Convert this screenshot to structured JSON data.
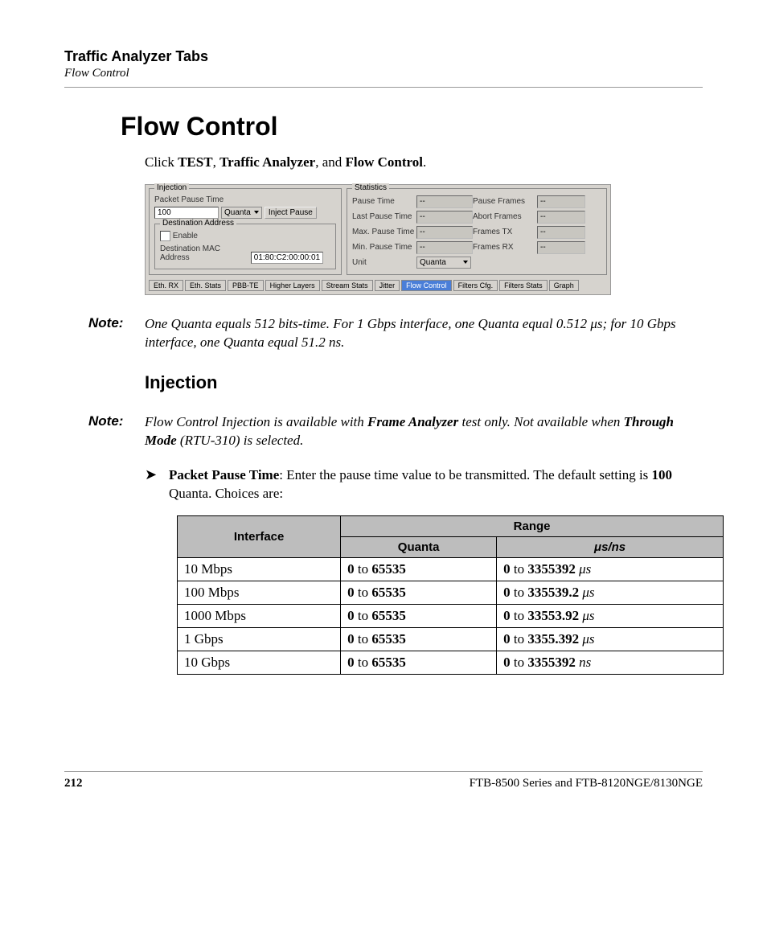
{
  "header": {
    "title": "Traffic Analyzer Tabs",
    "subtitle": "Flow Control"
  },
  "h1": "Flow Control",
  "intro": {
    "prefix": "Click ",
    "b1": "TEST",
    "sep1": ", ",
    "b2": "Traffic Analyzer",
    "sep2": ", and ",
    "b3": "Flow Control",
    "suffix": "."
  },
  "mock": {
    "injection_title": "Injection",
    "stats_title": "Statistics",
    "packet_pause_label": "Packet Pause Time",
    "packet_pause_value": "100",
    "quanta_sel": "Quanta",
    "inject_btn": "Inject Pause",
    "dest_addr_title": "Destination Address",
    "enable_label": "Enable",
    "dest_mac_label": "Destination MAC Address",
    "dest_mac_value": "01:80:C2:00:00:01",
    "stat_labels": [
      "Pause Time",
      "Last Pause Time",
      "Max. Pause Time",
      "Min. Pause Time"
    ],
    "stat_labels2": [
      "Pause Frames",
      "Abort Frames",
      "Frames TX",
      "Frames RX"
    ],
    "dash": "--",
    "unit_label": "Unit",
    "unit_value": "Quanta",
    "tabs": [
      "Eth. RX",
      "Eth. Stats",
      "PBB-TE",
      "Higher Layers",
      "Stream Stats",
      "Jitter",
      "Flow Control",
      "Filters Cfg.",
      "Filters Stats",
      "Graph"
    ]
  },
  "note1_label": "Note:",
  "note1_text": "One Quanta equals 512 bits-time. For 1 Gbps interface, one Quanta equal 0.512 μs; for 10 Gbps interface, one Quanta equal 51.2 ns.",
  "h2": "Injection",
  "note2_label": "Note:",
  "note2": {
    "p1": "Flow Control Injection is available with ",
    "b1": "Frame Analyzer",
    "p2": " test only. Not available when ",
    "b2": "Through Mode",
    "p3": " (RTU-310) is selected."
  },
  "bullet": {
    "b1": "Packet Pause Time",
    "p1": ": Enter the pause time value to be transmitted. The default setting is ",
    "b2": "100",
    "p2": " Quanta. Choices are:"
  },
  "table": {
    "h_interface": "Interface",
    "h_range": "Range",
    "h_quanta": "Quanta",
    "h_us": "μs/ns",
    "rows": [
      {
        "if": "10 Mbps",
        "q_lo": "0",
        "q_mid": " to ",
        "q_hi": "65535",
        "r_lo": "0",
        "r_mid": " to ",
        "r_hi": "3355392",
        "r_unit": " μs"
      },
      {
        "if": "100 Mbps",
        "q_lo": "0",
        "q_mid": " to ",
        "q_hi": "65535",
        "r_lo": "0",
        "r_mid": " to ",
        "r_hi": "335539.2",
        "r_unit": " μs"
      },
      {
        "if": "1000 Mbps",
        "q_lo": "0",
        "q_mid": " to ",
        "q_hi": "65535",
        "r_lo": "0",
        "r_mid": " to ",
        "r_hi": "33553.92",
        "r_unit": " μs"
      },
      {
        "if": "1 Gbps",
        "q_lo": "0",
        "q_mid": " to ",
        "q_hi": "65535",
        "r_lo": "0",
        "r_mid": " to ",
        "r_hi": "3355.392",
        "r_unit": " μs"
      },
      {
        "if": "10 Gbps",
        "q_lo": "0",
        "q_mid": " to ",
        "q_hi": "65535",
        "r_lo": "0",
        "r_mid": " to ",
        "r_hi": "3355392",
        "r_unit": " ns"
      }
    ]
  },
  "footer": {
    "page": "212",
    "doc": "FTB-8500 Series and FTB-8120NGE/8130NGE"
  }
}
